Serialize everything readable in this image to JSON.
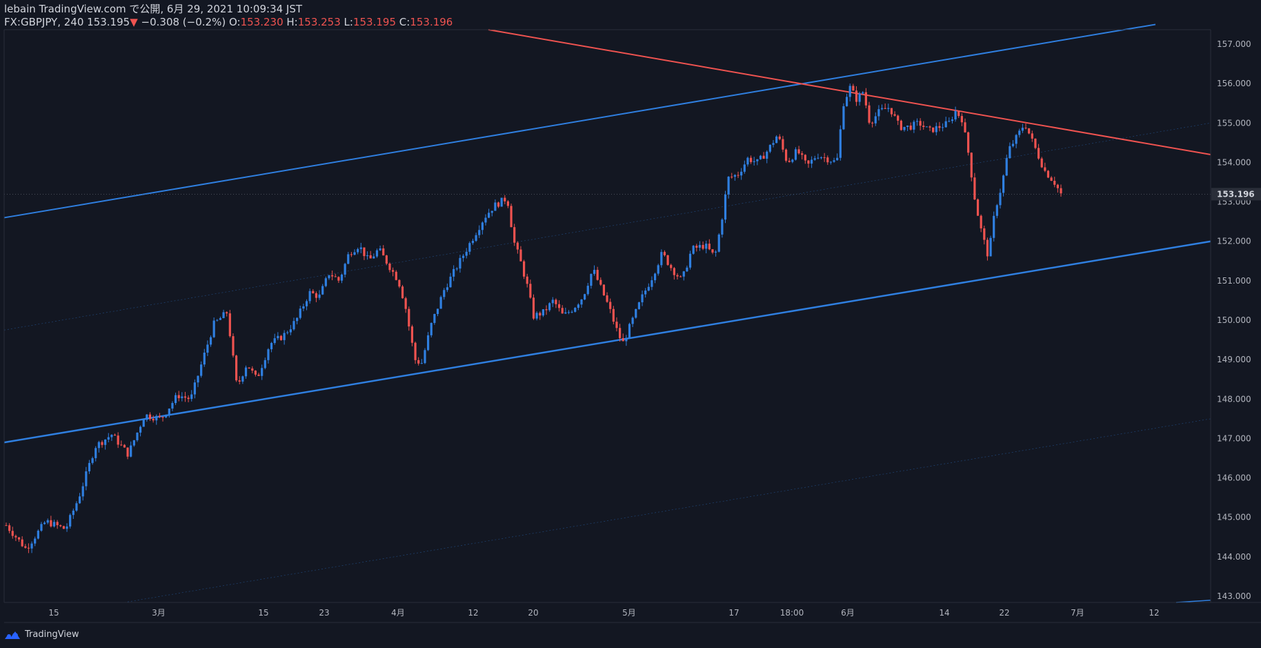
{
  "header": {
    "publisher": "lebain TradingView.com で公開, 6月 29, 2021 10:09:34 JST",
    "symbol_line_prefix": "FX:GBPJPY, 240 153.195",
    "change_arrow": "▼",
    "change": "−0.308 (−0.2%)",
    "o_label": "O:",
    "o_value": "153.230",
    "h_label": "H:",
    "h_value": "153.253",
    "l_label": "L:",
    "l_value": "153.195",
    "c_label": "C:",
    "c_value": "153.196"
  },
  "footer": {
    "brand": "TradingView",
    "logo_icon": "tradingview-logo-icon"
  },
  "colors": {
    "background": "#131722",
    "up": "#2f7fe0",
    "down": "#ef5350",
    "channel": "#2f7fe0",
    "resistance": "#ef5350",
    "axis_text": "#b2b5be"
  },
  "chart_data": {
    "type": "candlestick",
    "symbol": "FX:GBPJPY",
    "interval": "240",
    "ylim": [
      142.85,
      157.7
    ],
    "y_ticks": [
      "157.000",
      "156.000",
      "155.000",
      "154.000",
      "153.000",
      "152.000",
      "151.000",
      "150.000",
      "149.000",
      "148.000",
      "147.000",
      "146.000",
      "145.000",
      "144.000",
      "143.000"
    ],
    "x_ticks": [
      "15",
      "3月",
      "15",
      "23",
      "4月",
      "12",
      "20",
      "5月",
      "17",
      "18:00",
      "6月",
      "14",
      "22",
      "7月",
      "12"
    ],
    "last_price_label": "153.196",
    "close_path": [
      [
        0,
        144.8
      ],
      [
        6,
        144.2
      ],
      [
        12,
        144.9
      ],
      [
        18,
        144.7
      ],
      [
        22,
        145.5
      ],
      [
        27,
        146.8
      ],
      [
        32,
        147.1
      ],
      [
        37,
        146.6
      ],
      [
        42,
        147.6
      ],
      [
        47,
        147.5
      ],
      [
        52,
        148.1
      ],
      [
        56,
        148.0
      ],
      [
        60,
        149.1
      ],
      [
        63,
        149.9
      ],
      [
        67,
        150.2
      ],
      [
        70,
        148.3
      ],
      [
        73,
        148.9
      ],
      [
        76,
        148.5
      ],
      [
        80,
        149.4
      ],
      [
        84,
        149.6
      ],
      [
        88,
        150.0
      ],
      [
        92,
        150.7
      ],
      [
        95,
        150.6
      ],
      [
        98,
        151.2
      ],
      [
        101,
        151.0
      ],
      [
        104,
        151.7
      ],
      [
        107,
        151.9
      ],
      [
        110,
        151.5
      ],
      [
        113,
        151.8
      ],
      [
        116,
        151.4
      ],
      [
        119,
        151.0
      ],
      [
        121,
        150.4
      ],
      [
        124,
        149.0
      ],
      [
        126,
        148.9
      ],
      [
        129,
        149.9
      ],
      [
        133,
        150.8
      ],
      [
        137,
        151.4
      ],
      [
        141,
        152.0
      ],
      [
        145,
        152.6
      ],
      [
        148,
        152.9
      ],
      [
        152,
        153.1
      ],
      [
        154,
        152.0
      ],
      [
        156,
        151.5
      ],
      [
        158,
        150.9
      ],
      [
        160,
        150.1
      ],
      [
        163,
        150.2
      ],
      [
        166,
        150.5
      ],
      [
        169,
        150.1
      ],
      [
        172,
        150.3
      ],
      [
        175,
        150.6
      ],
      [
        178,
        151.3
      ],
      [
        181,
        150.7
      ],
      [
        183,
        150.3
      ],
      [
        185,
        149.8
      ],
      [
        187,
        149.4
      ],
      [
        190,
        150.0
      ],
      [
        193,
        150.6
      ],
      [
        196,
        151.1
      ],
      [
        199,
        151.7
      ],
      [
        202,
        151.3
      ],
      [
        205,
        151.0
      ],
      [
        208,
        151.8
      ],
      [
        212,
        151.9
      ],
      [
        215,
        151.6
      ],
      [
        217,
        152.5
      ],
      [
        219,
        153.6
      ],
      [
        222,
        153.7
      ],
      [
        225,
        154.1
      ],
      [
        228,
        154.0
      ],
      [
        231,
        154.3
      ],
      [
        234,
        154.7
      ],
      [
        237,
        154.0
      ],
      [
        240,
        154.3
      ],
      [
        243,
        153.9
      ],
      [
        246,
        154.2
      ],
      [
        249,
        154.1
      ],
      [
        252,
        154.0
      ],
      [
        254,
        155.5
      ],
      [
        256,
        155.9
      ],
      [
        258,
        155.6
      ],
      [
        260,
        155.8
      ],
      [
        262,
        155.0
      ],
      [
        265,
        155.3
      ],
      [
        268,
        155.4
      ],
      [
        271,
        154.9
      ],
      [
        274,
        154.9
      ],
      [
        277,
        155.0
      ],
      [
        280,
        154.8
      ],
      [
        283,
        154.9
      ],
      [
        286,
        155.0
      ],
      [
        288,
        155.3
      ],
      [
        290,
        155.1
      ],
      [
        292,
        154.2
      ],
      [
        294,
        153.0
      ],
      [
        296,
        152.2
      ],
      [
        298,
        151.6
      ],
      [
        300,
        152.8
      ],
      [
        302,
        153.4
      ],
      [
        304,
        154.3
      ],
      [
        307,
        154.7
      ],
      [
        309,
        155.0
      ],
      [
        311,
        154.6
      ],
      [
        313,
        154.2
      ],
      [
        315,
        153.8
      ],
      [
        318,
        153.5
      ],
      [
        320,
        153.2
      ]
    ],
    "channel_upper": {
      "points": [
        [
          "start",
          "152.6"
        ],
        [
          "end",
          "157.5"
        ]
      ]
    },
    "channel_lower": {
      "points": [
        [
          "start",
          "146.9"
        ],
        [
          "end",
          "152.0"
        ]
      ]
    },
    "resistance_line": {
      "points": [
        [
          "start",
          "157.5"
        ],
        [
          "end",
          "154.2"
        ]
      ]
    }
  }
}
